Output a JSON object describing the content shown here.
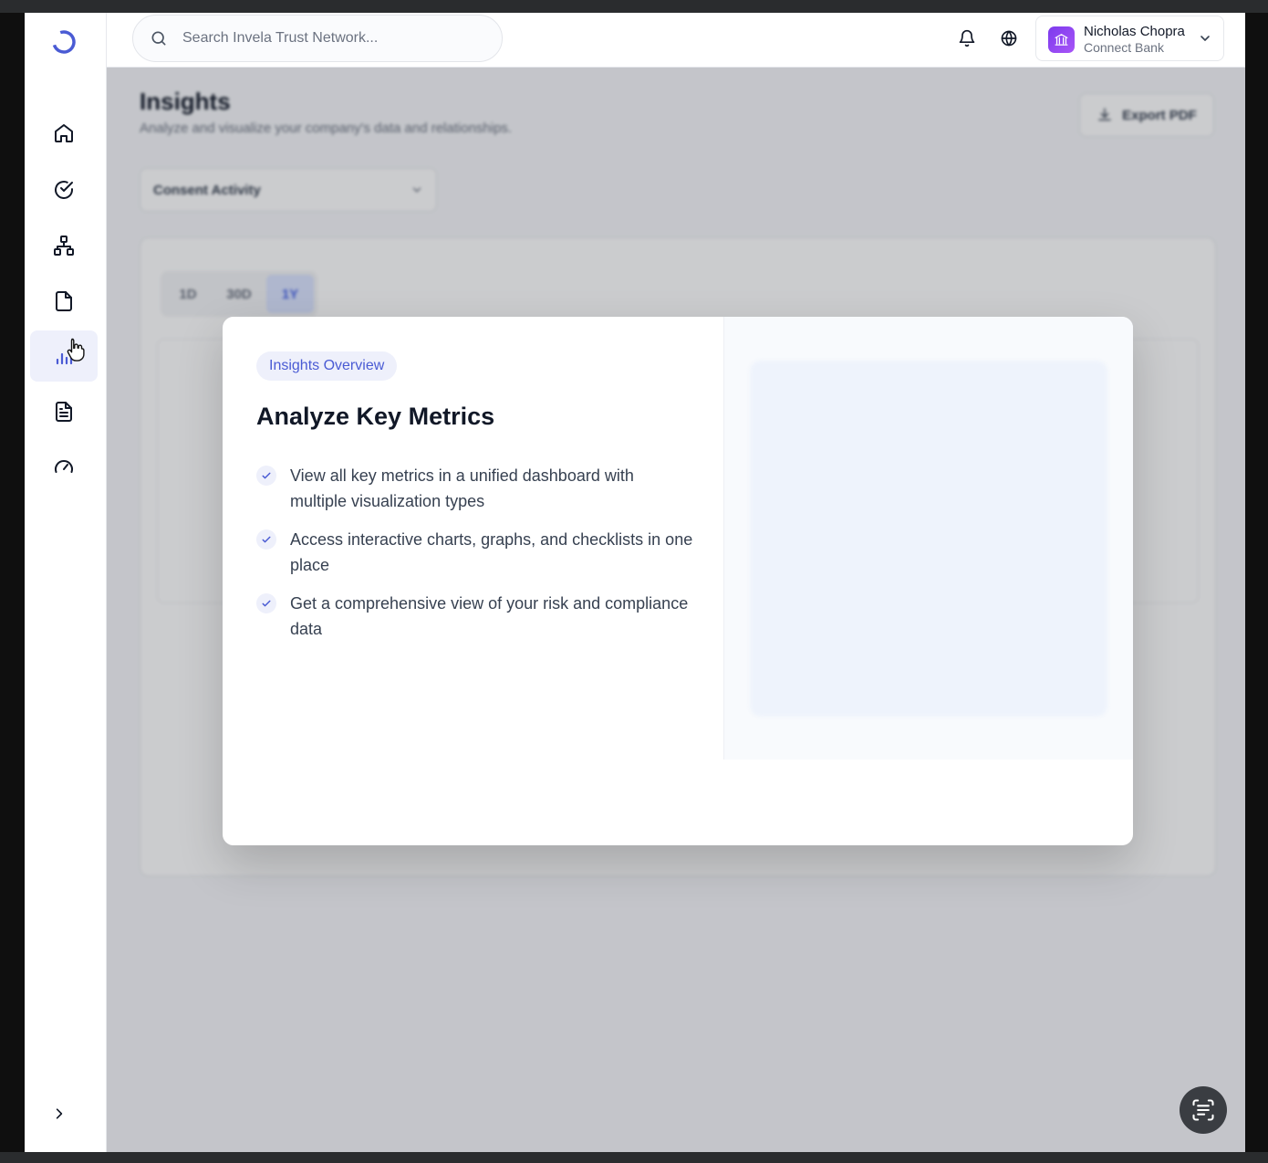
{
  "header": {
    "search_placeholder": "Search Invela Trust Network...",
    "user_name": "Nicholas Chopra",
    "user_org": "Connect Bank"
  },
  "sidebar": {
    "items": [
      {
        "icon": "home-icon"
      },
      {
        "icon": "check-circle-icon"
      },
      {
        "icon": "network-icon"
      },
      {
        "icon": "file-icon"
      },
      {
        "icon": "bar-chart-icon",
        "active": true
      },
      {
        "icon": "document-icon"
      },
      {
        "icon": "gauge-icon"
      }
    ]
  },
  "page": {
    "title": "Insights",
    "subtitle": "Analyze and visualize your company's data and relationships.",
    "export_label": "Export PDF",
    "select_value": "Consent Activity",
    "ranges": [
      "1D",
      "30D",
      "1Y"
    ],
    "active_range": "1Y"
  },
  "modal": {
    "tag": "Insights Overview",
    "title": "Analyze Key Metrics",
    "features": [
      "View all key metrics in a unified dashboard with multiple visualization types",
      "Access interactive charts, graphs, and checklists in one place",
      "Get a comprehensive view of your risk and compliance data"
    ]
  },
  "colors": {
    "accent": "#4a5bd4",
    "active_nav_bg": "#eef0fb",
    "avatar": "#8b3fe8"
  }
}
